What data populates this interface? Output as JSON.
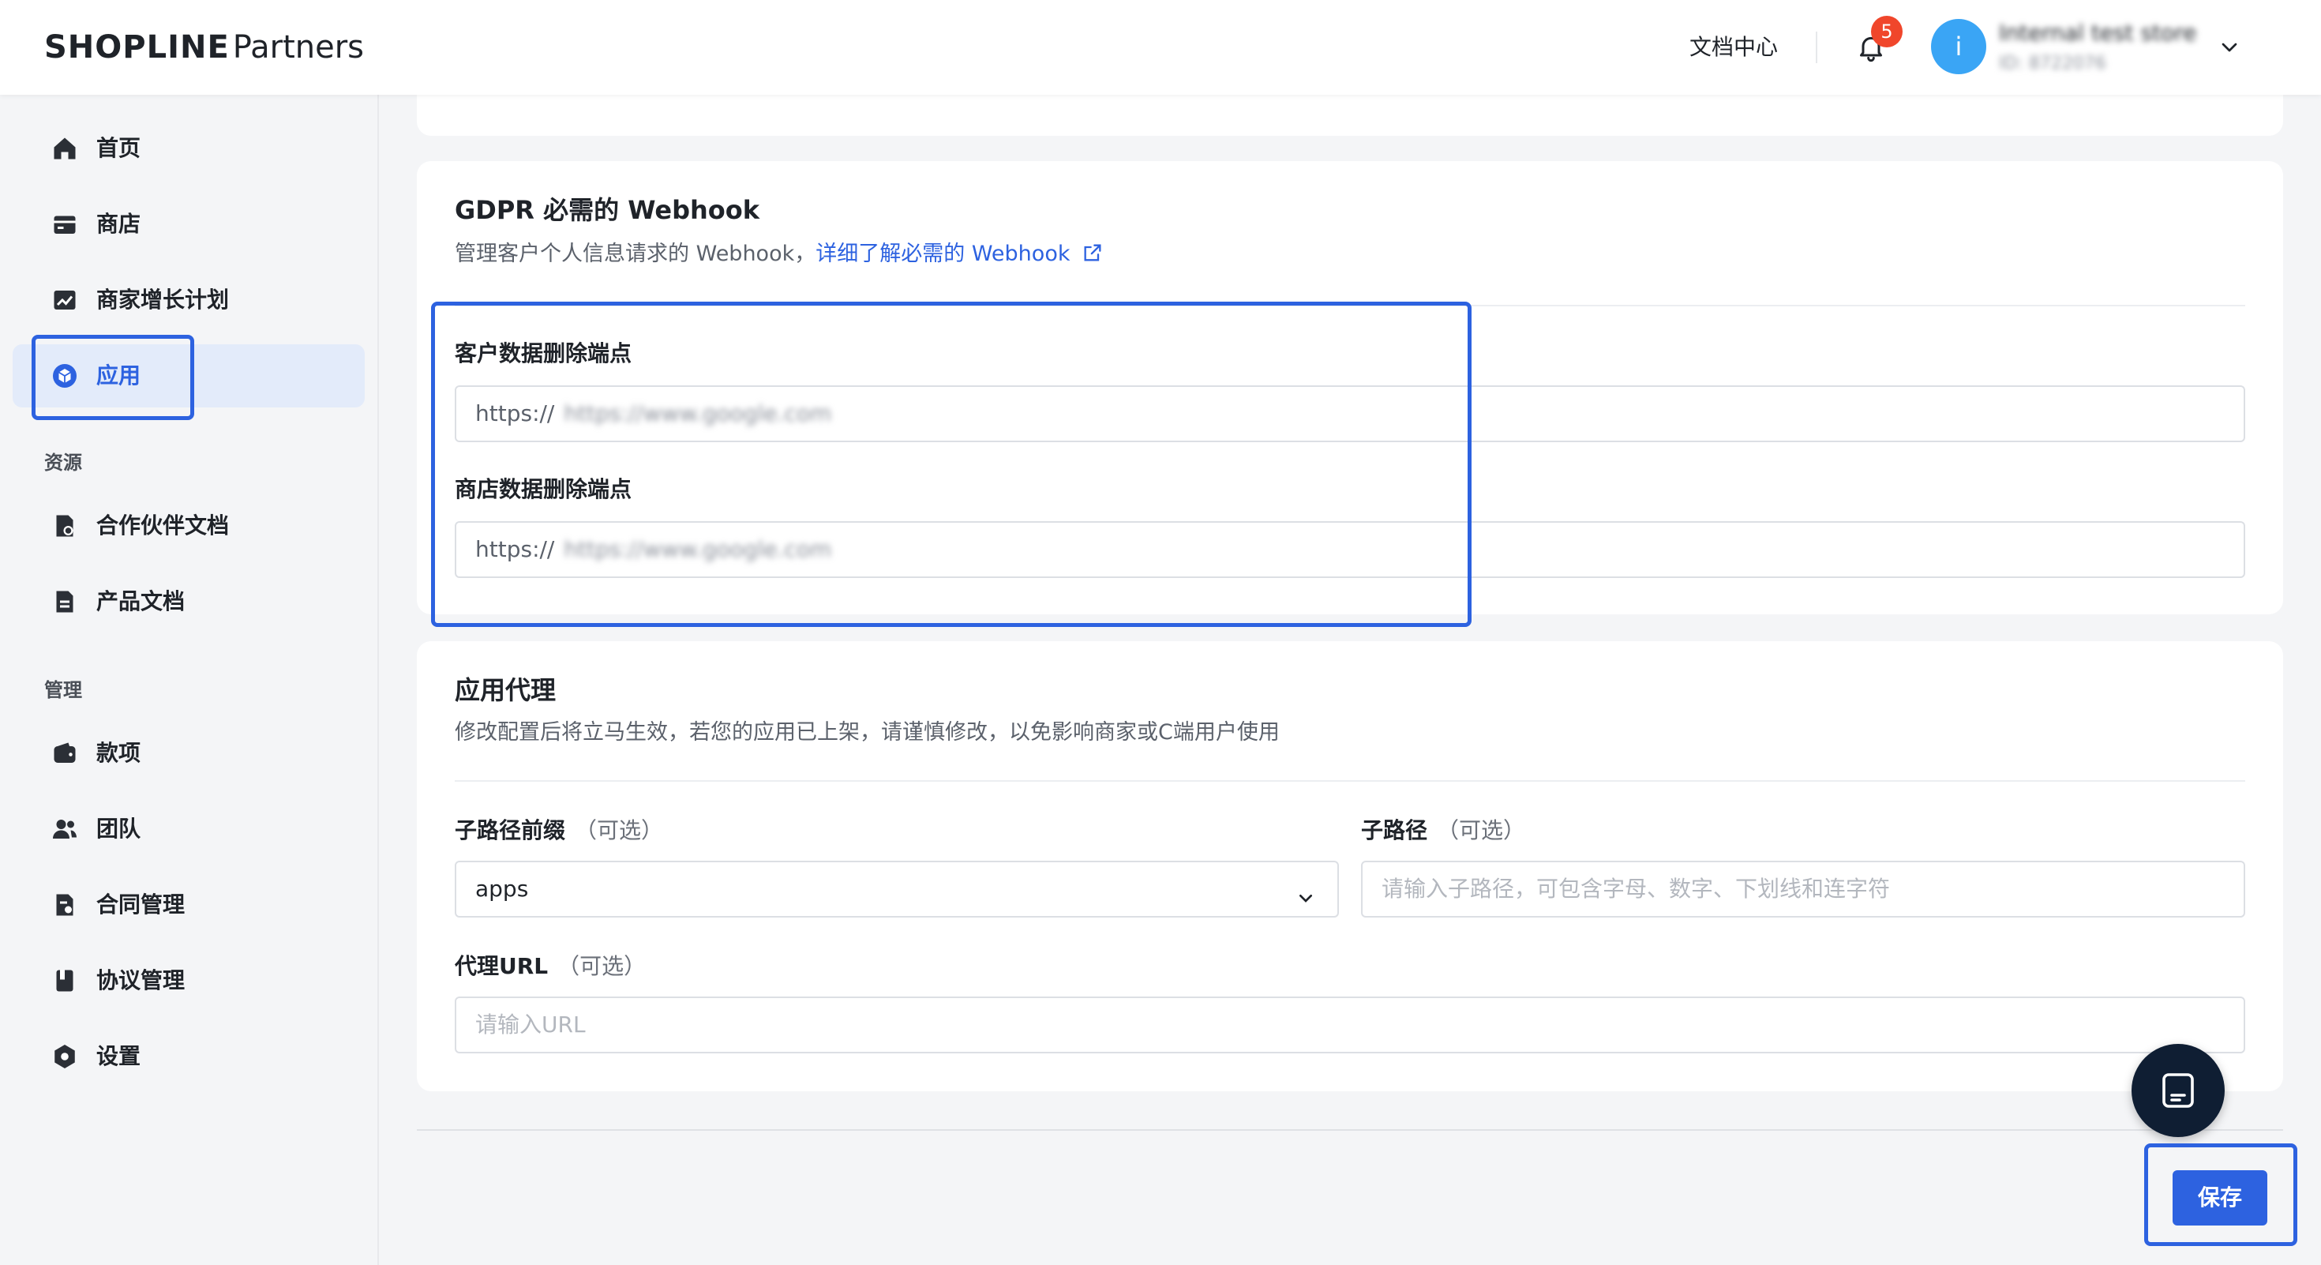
{
  "header": {
    "logo_brand": "SHOPLINE",
    "logo_sub": "Partners",
    "doc_center": "文档中心",
    "notification_count": "5",
    "avatar_initial": "i",
    "account_name": "Internal test store",
    "account_id": "ID: 8722076"
  },
  "sidebar": {
    "items": [
      {
        "label": "首页",
        "icon": "home-icon"
      },
      {
        "label": "商店",
        "icon": "store-icon"
      },
      {
        "label": "商家增长计划",
        "icon": "growth-chart-icon"
      },
      {
        "label": "应用",
        "icon": "app-cube-icon",
        "active": true
      }
    ],
    "resources_title": "资源",
    "resources": [
      {
        "label": "合作伙伴文档",
        "icon": "partner-doc-icon"
      },
      {
        "label": "产品文档",
        "icon": "product-doc-icon"
      }
    ],
    "manage_title": "管理",
    "manage": [
      {
        "label": "款项",
        "icon": "wallet-icon"
      },
      {
        "label": "团队",
        "icon": "team-icon"
      },
      {
        "label": "合同管理",
        "icon": "contract-icon"
      },
      {
        "label": "协议管理",
        "icon": "agreement-icon"
      },
      {
        "label": "设置",
        "icon": "settings-icon"
      }
    ]
  },
  "gdpr": {
    "title": "GDPR 必需的 Webhook",
    "desc": "管理客户个人信息请求的 Webhook，",
    "link": "详细了解必需的 Webhook",
    "customer_label": "客户数据删除端点",
    "customer_prefix": "https://",
    "customer_value": "https://www.google.com",
    "store_label": "商店数据删除端点",
    "store_prefix": "https://",
    "store_value": "https://www.google.com"
  },
  "proxy": {
    "title": "应用代理",
    "desc": "修改配置后将立马生效，若您的应用已上架，请谨慎修改，以免影响商家或C端用户使用",
    "subpath_prefix_label": "子路径前缀",
    "optional": "（可选）",
    "subpath_prefix_value": "apps",
    "subpath_label": "子路径",
    "subpath_placeholder": "请输入子路径，可包含字母、数字、下划线和连字符",
    "proxy_url_label": "代理URL",
    "proxy_url_placeholder": "请输入URL"
  },
  "actions": {
    "save": "保存"
  },
  "colors": {
    "accent": "#2d62e0",
    "badge": "#f0462b",
    "avatar": "#3aa5f5",
    "fab": "#0f1e33"
  }
}
